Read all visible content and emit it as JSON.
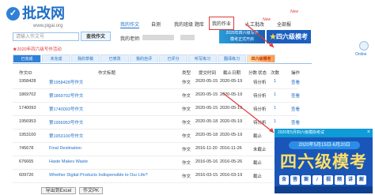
{
  "logo": {
    "name": "批改网",
    "url": "www.pigai.org"
  },
  "topnav": {
    "items": [
      "我的作文",
      "自测",
      "我的班级",
      "题库",
      "我的作业",
      "人工批改",
      "全部报"
    ],
    "badges": [
      "New",
      "New"
    ]
  },
  "search": {
    "placeholder": "请输入作文号",
    "button": "查找作文"
  },
  "teacher_label": "我的老师:",
  "promo_top": {
    "line1": "2020年四六级写作",
    "line2": "模考正式开启",
    "big": "四六级模考",
    "star": "★"
  },
  "red_banner": "★2020年四六级写作活动",
  "tabs": [
    "已完成",
    "未完成",
    "我的草稿",
    "已修改",
    "我的自评",
    "已评分",
    "听写练习",
    "翻译练习"
  ],
  "ad_tab": "四六级模考",
  "table_headers": [
    "作文ID",
    "作文标题",
    "类型",
    "提交时间",
    "截止日期",
    "分数",
    "状态",
    "次数",
    "操作"
  ],
  "rows": [
    {
      "id": "1958428",
      "title": "第1958428号作文",
      "type": "作文",
      "date": "2020-05-15",
      "deadline": "2020-05-19",
      "score": "",
      "status": "待分析",
      "count": "1",
      "action": "查看"
    },
    {
      "id": "1869702",
      "title": "第1869702号作文",
      "type": "作文",
      "date": "2020-05-15",
      "deadline": "2020-05-19",
      "score": "",
      "status": "待分析",
      "count": "1",
      "action": "查看"
    },
    {
      "id": "1740093",
      "title": "第1740093号作文",
      "type": "作文",
      "date": "2020-05-15",
      "deadline": "2020-05-19",
      "score": "",
      "status": "待分析",
      "count": "1",
      "action": "查看"
    },
    {
      "id": "1956953",
      "title": "第1956953号作文",
      "type": "作文",
      "date": "2020-05-18",
      "deadline": "2020-05-19",
      "score": "",
      "status": "待分析",
      "count": "1",
      "action": "查看"
    },
    {
      "id": "1953100",
      "title": "第1953100号作文",
      "type": "作文",
      "date": "2020-05-18",
      "deadline": "2020-05-19",
      "score": "",
      "status": "截止",
      "count": "1",
      "action": "查看"
    },
    {
      "id": "745678",
      "title": "Final Destination",
      "type": "作文",
      "date": "2016-11-20",
      "deadline": "2016-11-26",
      "score": "",
      "status": "未截止",
      "count": "1",
      "action": "查看"
    },
    {
      "id": "676665",
      "title": "Haste Makes Waste",
      "type": "作文",
      "date": "2016-05-16",
      "deadline": "2016-05-26",
      "score": "",
      "status": "截止",
      "count": "1",
      "action": "查看"
    },
    {
      "id": "609720",
      "title": "Whether Digital Products Indispensible to Our Life?",
      "type": "作文",
      "date": "2016-03-15",
      "deadline": "2016-03-19",
      "score": "",
      "status": "截止",
      "count": "1",
      "action": "查看"
    }
  ],
  "footer_buttons": [
    "导出到Excel",
    "作文PK"
  ],
  "popup": {
    "header": "2020年5月四六级模拟考试",
    "close": "×",
    "date": "2020年5月15日-6月20日",
    "big": "四六级模考",
    "chips": [
      "含",
      "答",
      "案",
      "/",
      "视",
      "频",
      "讲",
      "解"
    ]
  },
  "side": {
    "label": "Online"
  },
  "colors": {
    "accent": "#1f6fc5",
    "highlight": "#e03a3a",
    "promo": "#1a56b8"
  }
}
